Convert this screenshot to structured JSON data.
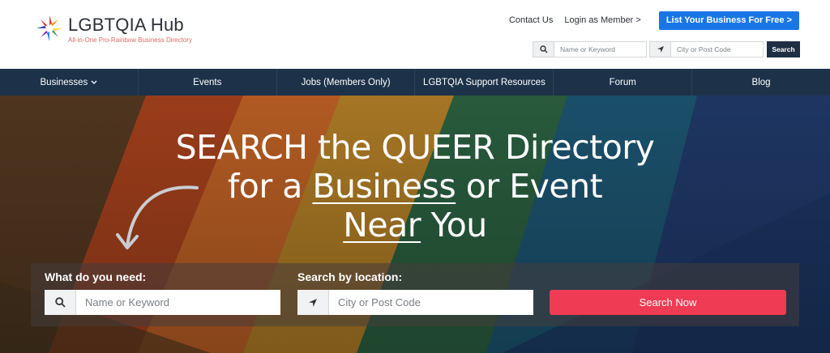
{
  "brand": {
    "name": "LGBTQIA Hub",
    "tagline": "All-in-One Pro-Rainbow Business Directory"
  },
  "header": {
    "links": [
      "Contact Us",
      "Login as Member >"
    ],
    "cta": "List Your Business For Free >"
  },
  "mini_search": {
    "keyword_placeholder": "Name or Keyword",
    "location_placeholder": "City or Post Code",
    "button": "Search"
  },
  "nav": {
    "items": [
      "Businesses",
      "Events",
      "Jobs (Members Only)",
      "LGBTQIA Support Resources",
      "Forum",
      "Blog"
    ]
  },
  "hero": {
    "line1": "SEARCH the QUEER Directory",
    "line2_pre": "for a ",
    "line2_u": "Business",
    "line2_post": " or Event",
    "line3_u": "Near",
    "line3_post": " You"
  },
  "main_search": {
    "what_label": "What do you need:",
    "where_label": "Search by location:",
    "keyword_placeholder": "Name or Keyword",
    "location_placeholder": "City or Post Code",
    "button": "Search Now"
  },
  "colors": {
    "nav_bg": "#1d3249",
    "cta_blue": "#1976e6",
    "search_red": "#ef3b53"
  }
}
